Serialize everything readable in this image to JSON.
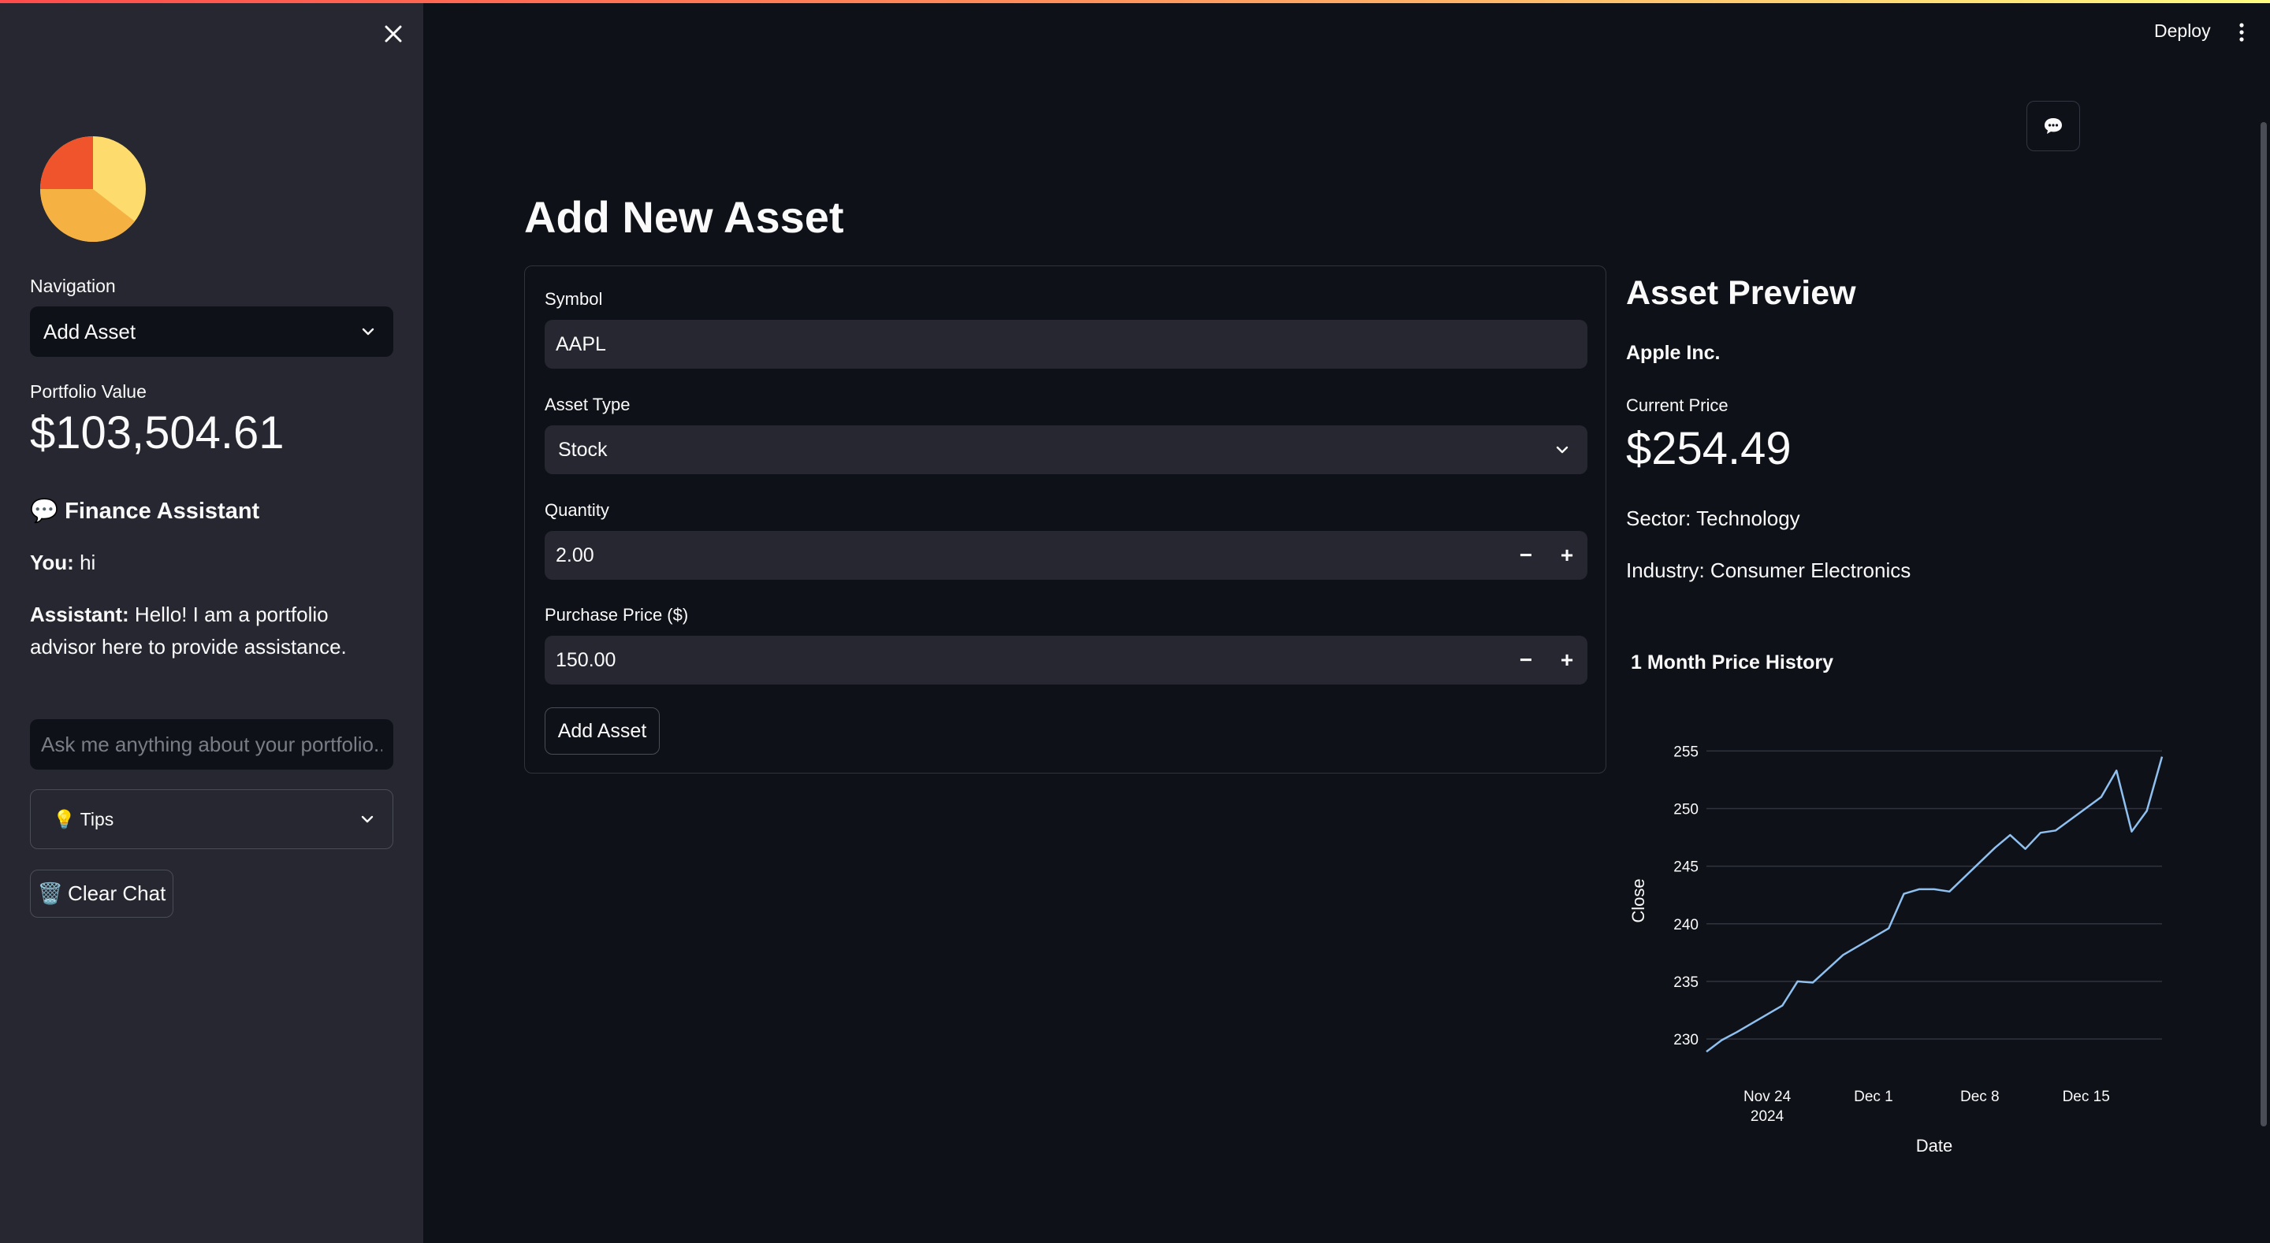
{
  "sidebar": {
    "navigation_label": "Navigation",
    "navigation_value": "Add Asset",
    "portfolio_label": "Portfolio Value",
    "portfolio_value": "$103,504.61",
    "assistant_icon": "💬",
    "assistant_title": "Finance Assistant",
    "chat": [
      {
        "speaker": "You:",
        "text": " hi"
      },
      {
        "speaker": "Assistant:",
        "text": " Hello! I am a portfolio advisor here to provide assistance."
      }
    ],
    "chat_placeholder": "Ask me anything about your portfolio...",
    "tips_icon": "💡",
    "tips_label": "Tips",
    "clear_icon": "🗑️",
    "clear_label": "Clear Chat"
  },
  "header": {
    "deploy_label": "Deploy"
  },
  "main": {
    "title": "Add New Asset",
    "form": {
      "symbol_label": "Symbol",
      "symbol_value": "AAPL",
      "asset_type_label": "Asset Type",
      "asset_type_value": "Stock",
      "quantity_label": "Quantity",
      "quantity_value": "2.00",
      "price_label": "Purchase Price ($)",
      "price_value": "150.00",
      "minus": "−",
      "plus": "+",
      "submit_label": "Add Asset"
    },
    "preview": {
      "title": "Asset Preview",
      "company": "Apple Inc.",
      "price_label": "Current Price",
      "price_value": "$254.49",
      "sector": "Sector: Technology",
      "industry": "Industry: Consumer Electronics",
      "chart_title": "1 Month Price History"
    }
  },
  "colors": {
    "accent_line": "#8fc0f0",
    "background": "#0e1117",
    "sidebar": "#262730"
  },
  "chart_data": {
    "type": "line",
    "xlabel": "Date",
    "ylabel": "Close",
    "ylim": [
      228.5,
      255.5
    ],
    "xlim": [
      "2024-11-20",
      "2024-12-20"
    ],
    "x_ticks": [
      {
        "value": "2024-11-24",
        "label": "Nov 24",
        "sublabel": "2024"
      },
      {
        "value": "2024-12-01",
        "label": "Dec 1",
        "sublabel": ""
      },
      {
        "value": "2024-12-08",
        "label": "Dec 8",
        "sublabel": ""
      },
      {
        "value": "2024-12-15",
        "label": "Dec 15",
        "sublabel": ""
      }
    ],
    "y_ticks": [
      230,
      235,
      240,
      245,
      250,
      255
    ],
    "grid": true,
    "series": [
      {
        "x": [
          "2024-11-20",
          "2024-11-21",
          "2024-11-22",
          "2024-11-25",
          "2024-11-26",
          "2024-11-27",
          "2024-11-29",
          "2024-12-02",
          "2024-12-03",
          "2024-12-04",
          "2024-12-05",
          "2024-12-06",
          "2024-12-09",
          "2024-12-10",
          "2024-12-11",
          "2024-12-12",
          "2024-12-13",
          "2024-12-16",
          "2024-12-17",
          "2024-12-18",
          "2024-12-19",
          "2024-12-20"
        ],
        "y": [
          228.9,
          229.9,
          230.6,
          232.9,
          235.0,
          234.9,
          237.3,
          239.6,
          242.6,
          243.0,
          243.0,
          242.8,
          246.6,
          247.7,
          246.5,
          247.9,
          248.1,
          251.0,
          253.3,
          248.0,
          249.8,
          254.5
        ]
      }
    ]
  }
}
